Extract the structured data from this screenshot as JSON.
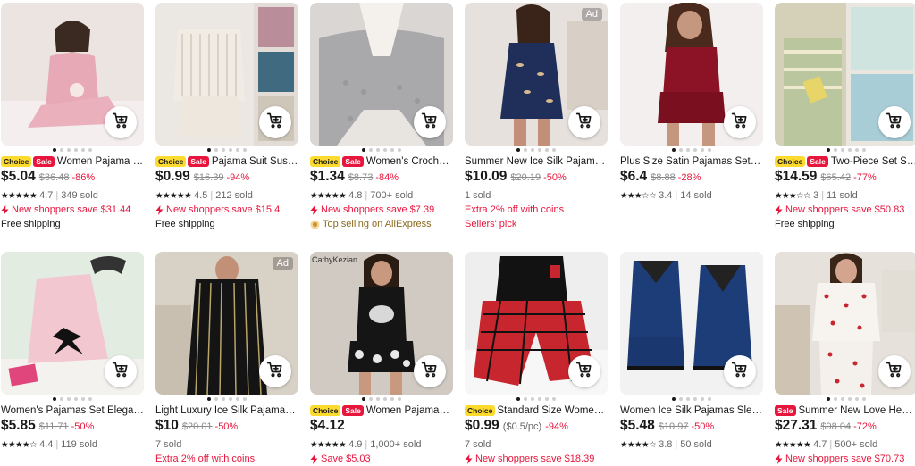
{
  "colors": {
    "accent": "#e6163d",
    "choice": "#fddb2e",
    "text": "#191919"
  },
  "products": [
    {
      "id": "p1",
      "ad": "",
      "watermark": "",
      "dots": [
        1,
        0,
        0,
        0,
        0,
        0
      ],
      "choice": "Choice",
      "sale": "Sale",
      "title": "Women Pajama Set...",
      "price": "$5.04",
      "unit": "",
      "orig": "$36.48",
      "discount": "-86%",
      "rating": 4.7,
      "rating_text": "4.7",
      "sold": "349 sold",
      "extras": [
        {
          "text": "New shoppers save $31.44",
          "style": "red",
          "icon": "flash-icon"
        },
        {
          "text": "Free shipping",
          "style": "plain",
          "icon": ""
        }
      ]
    },
    {
      "id": "p2",
      "ad": "",
      "watermark": "",
      "dots": [
        1,
        0,
        0,
        0,
        0,
        0
      ],
      "choice": "Choice",
      "sale": "Sale",
      "title": "Pajama Suit Suspe...",
      "price": "$0.99",
      "unit": "",
      "orig": "$16.39",
      "discount": "-94%",
      "rating": 4.5,
      "rating_text": "4.5",
      "sold": "212 sold",
      "extras": [
        {
          "text": "New shoppers save $15.4",
          "style": "red",
          "icon": "flash-icon"
        },
        {
          "text": "Free shipping",
          "style": "plain",
          "icon": ""
        }
      ]
    },
    {
      "id": "p3",
      "ad": "",
      "watermark": "",
      "dots": [
        1,
        0,
        0,
        0,
        0,
        0
      ],
      "choice": "Choice",
      "sale": "Sale",
      "title": "Women's Crochet ...",
      "price": "$1.34",
      "unit": "",
      "orig": "$8.73",
      "discount": "-84%",
      "rating": 4.8,
      "rating_text": "4.8",
      "sold": "700+ sold",
      "extras": [
        {
          "text": "New shoppers save $7.39",
          "style": "red",
          "icon": "flash-icon"
        },
        {
          "text": "Top selling on AliExpress",
          "style": "gold",
          "icon": "medal-icon"
        }
      ]
    },
    {
      "id": "p4",
      "ad": "Ad",
      "watermark": "",
      "dots": [
        1,
        0,
        0,
        0,
        0,
        0
      ],
      "choice": "",
      "sale": "",
      "title": "Summer New Ice Silk Pajamas...",
      "price": "$10.09",
      "unit": "",
      "orig": "$20.19",
      "discount": "-50%",
      "rating": null,
      "rating_text": "",
      "sold": "1 sold",
      "extras": [
        {
          "text": "Extra 2% off with coins",
          "style": "red",
          "icon": ""
        },
        {
          "text": "Sellers' pick",
          "style": "red",
          "icon": ""
        }
      ]
    },
    {
      "id": "p5",
      "ad": "",
      "watermark": "",
      "dots": [
        1,
        0,
        0,
        0,
        0,
        0
      ],
      "choice": "",
      "sale": "",
      "title": "Plus Size Satin Pajamas Set W...",
      "price": "$6.4",
      "unit": "",
      "orig": "$8.88",
      "discount": "-28%",
      "rating": 3.4,
      "rating_text": "3.4",
      "sold": "14 sold",
      "extras": []
    },
    {
      "id": "p6",
      "ad": "",
      "watermark": "",
      "dots": [
        1,
        0,
        0,
        0,
        0,
        0
      ],
      "choice": "Choice",
      "sale": "Sale",
      "title": "Two-Piece Set Set...",
      "price": "$14.59",
      "unit": "",
      "orig": "$65.42",
      "discount": "-77%",
      "rating": 3,
      "rating_text": "3",
      "sold": "11 sold",
      "extras": [
        {
          "text": "New shoppers save $50.83",
          "style": "red",
          "icon": "flash-icon"
        },
        {
          "text": "Free shipping",
          "style": "plain",
          "icon": ""
        }
      ]
    },
    {
      "id": "p7",
      "ad": "",
      "watermark": "",
      "dots": [
        1,
        0,
        0,
        0,
        0,
        0
      ],
      "choice": "",
      "sale": "",
      "title": "Women's Pajamas Set Elegant...",
      "price": "$5.85",
      "unit": "",
      "orig": "$11.71",
      "discount": "-50%",
      "rating": 4.4,
      "rating_text": "4.4",
      "sold": "119 sold",
      "extras": []
    },
    {
      "id": "p8",
      "ad": "Ad",
      "watermark": "",
      "dots": [
        1,
        0,
        0,
        0,
        0,
        0
      ],
      "choice": "",
      "sale": "",
      "title": "Light Luxury Ice Silk Pajamas ...",
      "price": "$10",
      "unit": "",
      "orig": "$20.01",
      "discount": "-50%",
      "rating": null,
      "rating_text": "",
      "sold": "7 sold",
      "extras": [
        {
          "text": "Extra 2% off with coins",
          "style": "red",
          "icon": ""
        }
      ]
    },
    {
      "id": "p9",
      "ad": "",
      "watermark": "CathyKezian",
      "dots": [
        1,
        0,
        0,
        0,
        0,
        0
      ],
      "choice": "Choice",
      "sale": "Sale",
      "title": "Women Pajamas S...",
      "price": "$4.12",
      "unit": "",
      "orig": "",
      "discount": "",
      "rating": 4.9,
      "rating_text": "4.9",
      "sold": "1,000+ sold",
      "extras": [
        {
          "text": "Save $5.03",
          "style": "red",
          "icon": "flash-icon"
        }
      ]
    },
    {
      "id": "p10",
      "ad": "",
      "watermark": "",
      "dots": [
        1,
        0,
        0,
        0,
        0,
        0
      ],
      "choice": "Choice",
      "sale": "",
      "title": "Standard Size Women's...",
      "price": "$0.99",
      "unit": "($0.5/pc)",
      "orig": "",
      "discount": "-94%",
      "rating": null,
      "rating_text": "",
      "sold": "7 sold",
      "extras": [
        {
          "text": "New shoppers save $18.39",
          "style": "red",
          "icon": "flash-icon"
        }
      ]
    },
    {
      "id": "p11",
      "ad": "",
      "watermark": "",
      "dots": [
        1,
        0,
        0,
        0,
        0,
        0
      ],
      "choice": "",
      "sale": "",
      "title": "Women Ice Silk Pajamas Slee...",
      "price": "$5.48",
      "unit": "",
      "orig": "$10.97",
      "discount": "-50%",
      "rating": 3.8,
      "rating_text": "3.8",
      "sold": "50 sold",
      "extras": []
    },
    {
      "id": "p12",
      "ad": "",
      "watermark": "",
      "dots": [
        1,
        0,
        0,
        0,
        0,
        0
      ],
      "choice": "",
      "sale": "Sale",
      "title": "Summer New Love Heart...",
      "price": "$27.31",
      "unit": "",
      "orig": "$98.04",
      "discount": "-72%",
      "rating": 4.7,
      "rating_text": "4.7",
      "sold": "500+ sold",
      "extras": [
        {
          "text": "New shoppers save $70.73",
          "style": "red",
          "icon": "flash-icon"
        }
      ]
    }
  ]
}
